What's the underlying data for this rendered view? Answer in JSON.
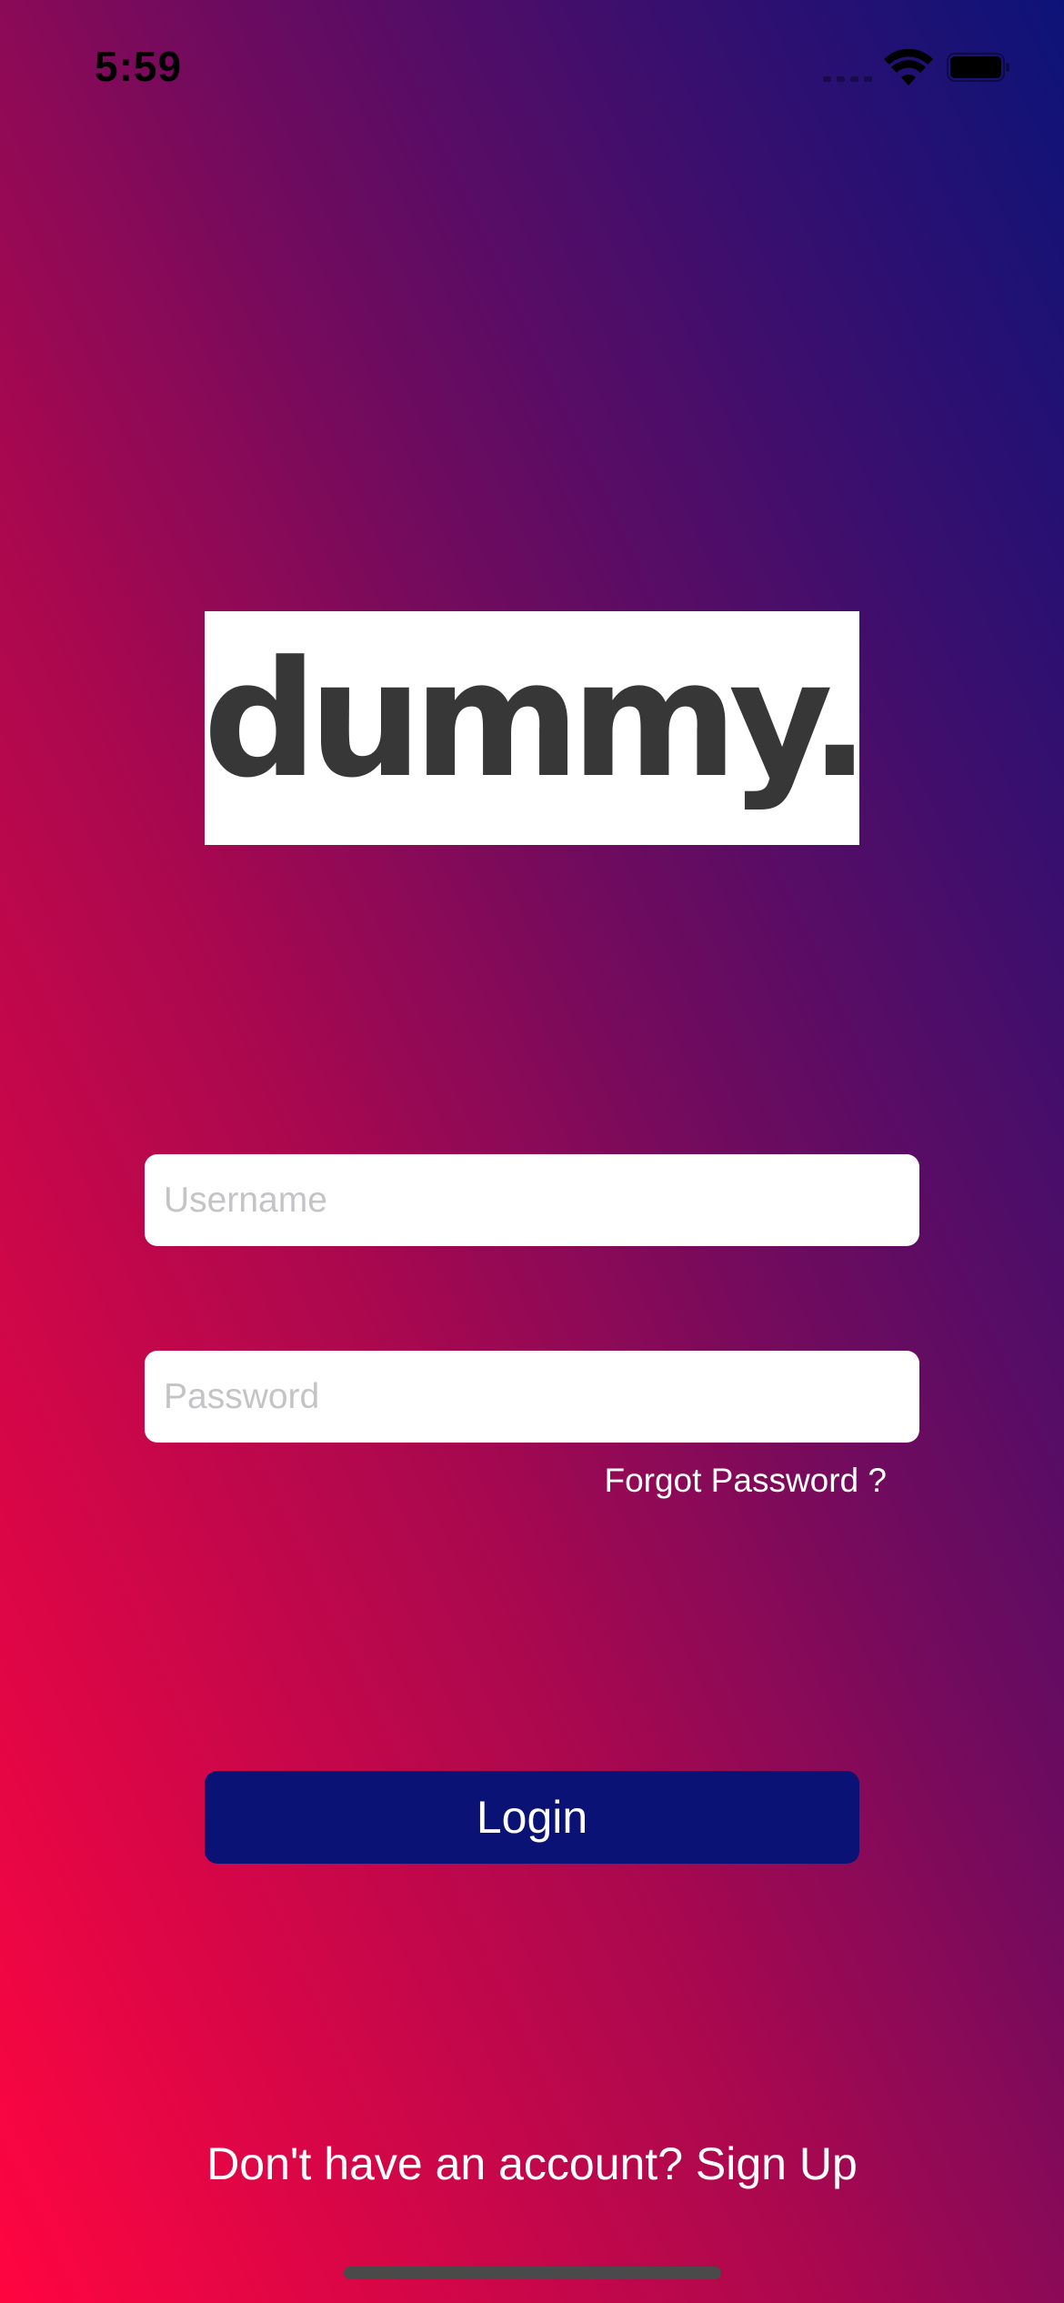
{
  "status_bar": {
    "time": "5:59",
    "icons": [
      "signal-icon",
      "wifi-icon",
      "battery-icon"
    ]
  },
  "logo": {
    "text": "dummy."
  },
  "form": {
    "username_placeholder": "Username",
    "username_value": "",
    "password_placeholder": "Password",
    "password_value": "",
    "forgot_label": "Forgot Password ?",
    "login_label": "Login"
  },
  "footer": {
    "signup_label": "Don't have an account? Sign Up"
  },
  "colors": {
    "gradient_start": "#ff0540",
    "gradient_end": "#0c1378",
    "login_button": "#0b1276",
    "logo_text": "#383737"
  }
}
